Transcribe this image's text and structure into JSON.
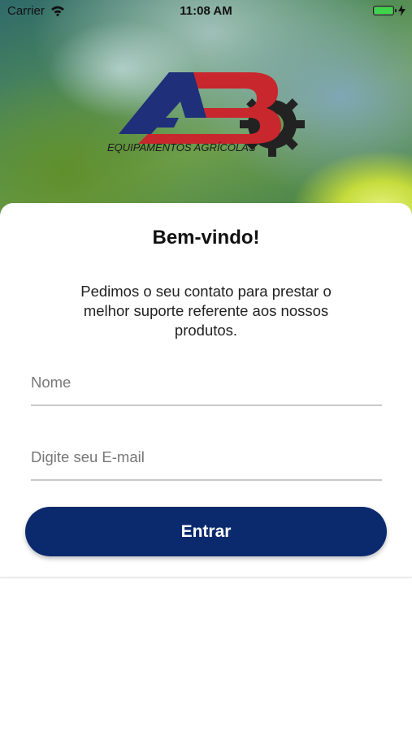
{
  "status_bar": {
    "carrier": "Carrier",
    "time": "11:08 AM",
    "wifi_icon": "wifi-icon",
    "battery_icon": "battery-icon",
    "charging_icon": "bolt-icon"
  },
  "header": {
    "logo_text": "EQUIPAMENTOS AGRÍCOLAS",
    "logo_mark": "AB",
    "logo_colors": {
      "navy": "#1f2f7a",
      "red": "#c8272d",
      "dark": "#222222"
    }
  },
  "login": {
    "title": "Bem-vindo!",
    "message": "Pedimos o seu contato para prestar o melhor suporte referente aos nossos produtos.",
    "name_placeholder": "Nome",
    "email_placeholder": "Digite seu E-mail",
    "submit_label": "Entrar",
    "accent_color": "#0b2a6e"
  }
}
